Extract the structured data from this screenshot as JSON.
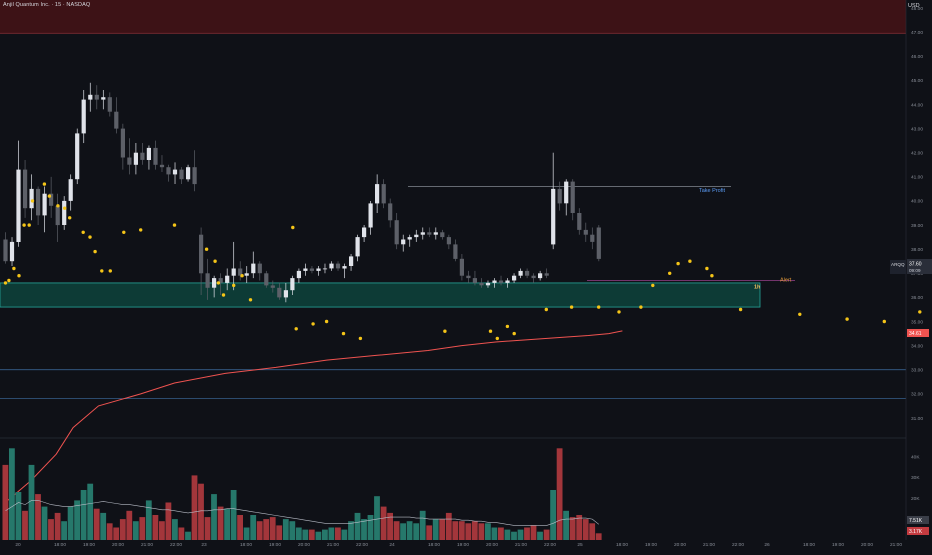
{
  "header": {
    "title": "Anjil Quantum Inc. · 15 · NASDAQ",
    "currency": "USD"
  },
  "price_axis": {
    "labels": [
      "48.00",
      "47.00",
      "46.00",
      "45.00",
      "44.00",
      "43.00",
      "42.00",
      "41.00",
      "40.00",
      "39.00",
      "38.00",
      "37.00",
      "36.00",
      "35.00",
      "34.00",
      "33.00",
      "32.00",
      "31.00"
    ],
    "values": [
      48,
      47,
      46,
      45,
      44,
      43,
      42,
      41,
      40,
      39,
      38,
      37,
      36,
      35,
      34,
      33,
      32,
      31
    ]
  },
  "volume_axis": {
    "labels": [
      "40K",
      "30K",
      "20K",
      "10K"
    ],
    "values": [
      40000,
      30000,
      20000,
      10000
    ]
  },
  "time_axis": {
    "labels": [
      "20",
      "18:00",
      "19:00",
      "20:00",
      "21:00",
      "22:00",
      "23",
      "18:00",
      "19:00",
      "20:00",
      "21:00",
      "22:00",
      "24",
      "18:00",
      "19:00",
      "20:00",
      "21:00",
      "22:00",
      "25",
      "18:00",
      "19:00",
      "20:00",
      "21:00",
      "22:00",
      "26",
      "18:00",
      "19:00",
      "20:00",
      "21:00"
    ]
  },
  "badges": {
    "symbol": "ARQQ",
    "price": "37.60",
    "countdown": "09:09",
    "ma_value": "34.61",
    "vol_ma": "7.51K",
    "vol_last": "3.17K"
  },
  "annotations": {
    "take_profit": "Take Profit",
    "alert": "Alert",
    "interval": "1h"
  },
  "colors": {
    "background": "#0f1117",
    "up": "#e0e3ea",
    "down": "#5d6068",
    "dots": "#f5c518",
    "ma": "#ef5350",
    "zone_fill": "#0d3b36",
    "zone_border": "#26a69a",
    "danger_zone": "#3d1216",
    "take_profit": "#5b9cf6",
    "alert": "#e39a3b",
    "vol_up": "#26786b",
    "vol_down": "#a3363b",
    "hline": "#4a86c5"
  },
  "chart_data": {
    "type": "candlestick",
    "symbol": "ARQQ",
    "interval": "15",
    "ylim": [
      30.5,
      48.6
    ],
    "candles": [
      [
        38.4,
        38.7,
        37.4,
        37.5
      ],
      [
        37.5,
        38.5,
        37.3,
        38.3
      ],
      [
        38.3,
        42.5,
        38.1,
        41.3
      ],
      [
        41.3,
        41.7,
        39.3,
        39.7
      ],
      [
        39.7,
        41.1,
        39.2,
        40.5
      ],
      [
        40.5,
        40.6,
        39.0,
        39.4
      ],
      [
        39.4,
        40.6,
        38.7,
        40.3
      ],
      [
        40.3,
        41.0,
        39.3,
        39.8
      ],
      [
        39.8,
        40.3,
        38.3,
        39.0
      ],
      [
        39.0,
        40.2,
        38.8,
        40.0
      ],
      [
        40.0,
        41.1,
        39.6,
        40.9
      ],
      [
        40.9,
        43.0,
        40.7,
        42.8
      ],
      [
        42.8,
        44.6,
        42.4,
        44.2
      ],
      [
        44.2,
        44.9,
        43.7,
        44.4
      ],
      [
        44.4,
        44.8,
        43.8,
        44.2
      ],
      [
        44.2,
        44.6,
        43.8,
        44.3
      ],
      [
        44.3,
        44.5,
        43.5,
        43.7
      ],
      [
        43.7,
        44.3,
        42.8,
        43.0
      ],
      [
        43.0,
        43.2,
        41.3,
        41.8
      ],
      [
        41.8,
        42.6,
        41.1,
        41.5
      ],
      [
        41.5,
        42.4,
        41.1,
        42.0
      ],
      [
        42.0,
        42.4,
        41.5,
        41.7
      ],
      [
        41.7,
        42.3,
        41.3,
        42.2
      ],
      [
        42.2,
        42.5,
        41.3,
        41.5
      ],
      [
        41.5,
        41.9,
        41.2,
        41.4
      ],
      [
        41.4,
        41.5,
        40.8,
        41.1
      ],
      [
        41.1,
        41.6,
        40.7,
        41.3
      ],
      [
        41.3,
        41.4,
        40.7,
        40.9
      ],
      [
        40.9,
        41.5,
        40.8,
        41.4
      ],
      [
        41.4,
        42.1,
        40.4,
        40.7
      ],
      [
        38.6,
        38.9,
        36.1,
        37.0
      ],
      [
        37.0,
        37.6,
        35.9,
        36.4
      ],
      [
        36.4,
        36.9,
        36.0,
        36.8
      ],
      [
        36.8,
        37.0,
        36.1,
        36.6
      ],
      [
        36.6,
        37.2,
        36.3,
        36.9
      ],
      [
        36.9,
        38.3,
        36.3,
        37.2
      ],
      [
        37.2,
        37.5,
        36.7,
        36.9
      ],
      [
        36.9,
        37.3,
        36.6,
        37.0
      ],
      [
        37.0,
        37.9,
        36.8,
        37.4
      ],
      [
        37.4,
        37.5,
        36.7,
        37.0
      ],
      [
        37.0,
        37.1,
        36.4,
        36.5
      ],
      [
        36.5,
        36.7,
        36.2,
        36.4
      ],
      [
        36.4,
        36.6,
        35.9,
        36.0
      ],
      [
        36.0,
        36.6,
        35.8,
        36.3
      ],
      [
        36.3,
        36.9,
        36.1,
        36.8
      ],
      [
        36.8,
        37.2,
        36.6,
        37.1
      ],
      [
        37.1,
        37.4,
        36.9,
        37.2
      ],
      [
        37.2,
        37.3,
        37.0,
        37.1
      ],
      [
        37.1,
        37.3,
        36.9,
        37.2
      ],
      [
        37.2,
        37.4,
        37.0,
        37.2
      ],
      [
        37.2,
        37.5,
        37.1,
        37.4
      ],
      [
        37.4,
        37.5,
        37.1,
        37.2
      ],
      [
        37.2,
        37.4,
        36.8,
        37.3
      ],
      [
        37.3,
        37.8,
        37.1,
        37.7
      ],
      [
        37.7,
        38.6,
        37.5,
        38.5
      ],
      [
        38.5,
        39.0,
        38.3,
        38.9
      ],
      [
        38.9,
        40.0,
        38.6,
        39.9
      ],
      [
        39.9,
        41.1,
        39.5,
        40.7
      ],
      [
        40.7,
        40.9,
        39.7,
        39.9
      ],
      [
        39.9,
        40.1,
        38.9,
        39.2
      ],
      [
        39.2,
        39.5,
        38.0,
        38.2
      ],
      [
        38.2,
        38.6,
        37.9,
        38.4
      ],
      [
        38.4,
        38.6,
        38.1,
        38.5
      ],
      [
        38.5,
        38.8,
        38.3,
        38.6
      ],
      [
        38.6,
        38.9,
        38.4,
        38.7
      ],
      [
        38.7,
        38.9,
        38.5,
        38.6
      ],
      [
        38.6,
        38.9,
        38.4,
        38.7
      ],
      [
        38.7,
        38.8,
        38.4,
        38.5
      ],
      [
        38.5,
        38.6,
        38.0,
        38.2
      ],
      [
        38.2,
        38.4,
        37.5,
        37.6
      ],
      [
        37.6,
        37.8,
        36.7,
        36.9
      ],
      [
        36.9,
        37.1,
        36.6,
        36.8
      ],
      [
        36.8,
        37.1,
        36.5,
        36.6
      ],
      [
        36.6,
        36.8,
        36.4,
        36.5
      ],
      [
        36.5,
        36.7,
        36.4,
        36.6
      ],
      [
        36.6,
        36.8,
        36.4,
        36.7
      ],
      [
        36.7,
        36.9,
        36.5,
        36.6
      ],
      [
        36.6,
        36.8,
        36.4,
        36.7
      ],
      [
        36.7,
        37.0,
        36.6,
        36.9
      ],
      [
        36.9,
        37.2,
        36.8,
        37.1
      ],
      [
        37.1,
        37.2,
        36.8,
        36.9
      ],
      [
        36.9,
        37.0,
        36.6,
        36.8
      ],
      [
        36.8,
        37.1,
        36.7,
        37.0
      ],
      [
        37.0,
        37.2,
        36.8,
        36.9
      ],
      [
        38.2,
        42.0,
        38.0,
        40.5
      ],
      [
        40.5,
        40.8,
        39.6,
        39.9
      ],
      [
        39.9,
        40.9,
        39.4,
        40.8
      ],
      [
        40.8,
        40.9,
        39.2,
        39.5
      ],
      [
        39.5,
        39.7,
        38.6,
        38.8
      ],
      [
        38.8,
        39.1,
        38.3,
        38.6
      ],
      [
        38.6,
        38.9,
        38.0,
        38.3
      ],
      [
        38.9,
        39.0,
        37.5,
        37.6
      ]
    ],
    "volume": [
      36000,
      44000,
      23000,
      14000,
      36000,
      22000,
      16000,
      10000,
      13000,
      9000,
      16000,
      19000,
      24000,
      27000,
      15000,
      13000,
      8000,
      6000,
      10000,
      14000,
      9000,
      11000,
      19000,
      12000,
      9000,
      18000,
      10000,
      6000,
      4000,
      31000,
      27000,
      11000,
      22000,
      16000,
      15000,
      24000,
      12000,
      6000,
      12000,
      9000,
      10000,
      11000,
      7000,
      10000,
      9000,
      6000,
      5000,
      5000,
      4000,
      5000,
      6000,
      6000,
      5000,
      9000,
      13000,
      10000,
      12000,
      21000,
      16000,
      13000,
      9000,
      8000,
      9000,
      8000,
      14000,
      7000,
      10000,
      10000,
      13000,
      9000,
      9000,
      8000,
      9000,
      8000,
      8000,
      6000,
      6000,
      5000,
      4000,
      5000,
      6000,
      7000,
      4000,
      5000,
      24000,
      44000,
      14000,
      11000,
      12000,
      10000,
      8000,
      3200
    ],
    "moving_average": [
      [
        0,
        27.5
      ],
      [
        15,
        28.4
      ],
      [
        30,
        29.5
      ],
      [
        40,
        30.6
      ],
      [
        55,
        31.5
      ],
      [
        80,
        32.0
      ],
      [
        100,
        32.45
      ],
      [
        130,
        32.85
      ],
      [
        160,
        33.1
      ],
      [
        190,
        33.4
      ],
      [
        220,
        33.6
      ],
      [
        250,
        33.8
      ],
      [
        270,
        34.0
      ],
      [
        290,
        34.15
      ],
      [
        310,
        34.25
      ],
      [
        330,
        34.35
      ],
      [
        345,
        34.42
      ],
      [
        357,
        34.5
      ],
      [
        365,
        34.61
      ]
    ],
    "volume_ma": [
      14000,
      16000,
      18000,
      17000,
      19000,
      19000,
      18000,
      17000,
      16500,
      16000,
      16000,
      16500,
      17000,
      17500,
      18000,
      18500,
      18000,
      17500,
      17000,
      17000,
      16500,
      16000,
      15500,
      15000,
      14500,
      14500,
      14000,
      13500,
      13000,
      13500,
      14000,
      14000,
      14500,
      14500,
      15000,
      15000,
      14500,
      14000,
      13500,
      13000,
      12500,
      12000,
      11500,
      11000,
      10500,
      10000,
      9500,
      9000,
      8500,
      8000,
      8000,
      8000,
      8000,
      8000,
      8500,
      9000,
      9500,
      10000,
      10500,
      11000,
      11000,
      11000,
      11000,
      10500,
      10500,
      10000,
      10000,
      10000,
      10000,
      10000,
      9500,
      9500,
      9000,
      9000,
      8500,
      8500,
      8000,
      7500,
      7000,
      7000,
      7000,
      7000,
      7000,
      7000,
      8000,
      9500,
      10000,
      10000,
      10500,
      10500,
      10000,
      7510
    ],
    "volume_ylim": [
      0,
      47000
    ],
    "markers": [
      [
        0,
        37.9
      ],
      [
        2,
        38.0
      ],
      [
        5,
        38.5
      ],
      [
        8,
        38.2
      ],
      [
        11,
        40.3
      ],
      [
        14,
        40.3
      ],
      [
        16,
        41.3
      ],
      [
        23,
        42.0
      ],
      [
        26,
        41.5
      ],
      [
        31,
        41.1
      ],
      [
        35,
        41.0
      ],
      [
        38,
        40.6
      ],
      [
        46,
        40.0
      ],
      [
        50,
        39.8
      ],
      [
        53,
        39.2
      ],
      [
        57,
        38.4
      ],
      [
        62,
        38.4
      ],
      [
        70,
        40.0
      ],
      [
        80,
        40.1
      ],
      [
        100,
        40.3
      ],
      [
        119,
        39.3
      ],
      [
        124,
        38.8
      ],
      [
        126,
        37.9
      ],
      [
        129,
        37.4
      ],
      [
        135,
        37.8
      ],
      [
        140,
        38.2
      ],
      [
        145,
        37.2
      ],
      [
        170,
        40.2
      ],
      [
        172,
        36.0
      ],
      [
        182,
        36.2
      ],
      [
        190,
        36.3
      ],
      [
        200,
        35.8
      ],
      [
        210,
        35.6
      ],
      [
        260,
        35.9
      ],
      [
        287,
        35.9
      ],
      [
        291,
        35.6
      ],
      [
        297,
        36.1
      ],
      [
        301,
        35.8
      ],
      [
        320,
        36.8
      ],
      [
        335,
        36.9
      ],
      [
        351,
        36.9
      ],
      [
        363,
        36.7
      ],
      [
        376,
        36.9
      ],
      [
        383,
        37.8
      ],
      [
        393,
        38.3
      ],
      [
        398,
        38.7
      ],
      [
        405,
        38.8
      ],
      [
        415,
        38.5
      ],
      [
        418,
        38.2
      ],
      [
        435,
        36.8
      ],
      [
        470,
        36.6
      ],
      [
        498,
        36.4
      ],
      [
        520,
        36.3
      ],
      [
        541,
        36.7
      ],
      [
        553,
        36.6
      ],
      [
        560,
        36.6
      ],
      [
        572,
        36.3
      ],
      [
        579,
        38.1
      ],
      [
        594,
        39.5
      ],
      [
        602,
        38.4
      ],
      [
        608,
        38.4
      ],
      [
        614,
        38.3
      ]
    ],
    "zones": [
      {
        "y0": 46.95,
        "y1": 48.6,
        "type": "danger"
      },
      {
        "y0": 35.6,
        "y1": 36.6,
        "type": "support"
      }
    ],
    "hlines": [
      33.0,
      31.8
    ],
    "take_profit": 40.6,
    "alert_level": 36.7,
    "last_price": 37.6,
    "ma_last": 34.61
  }
}
